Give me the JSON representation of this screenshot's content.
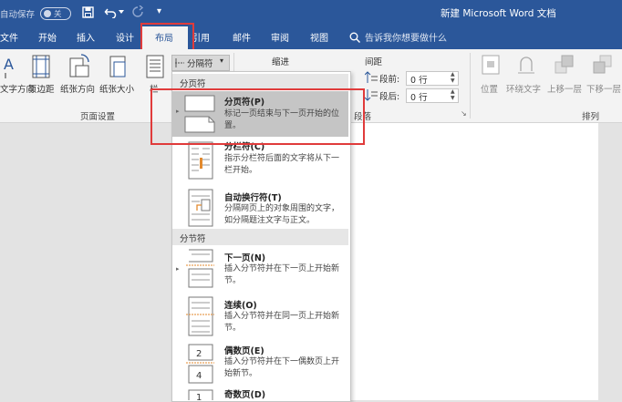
{
  "titlebar": {
    "autosave_label": "自动保存",
    "autosave_state": "关",
    "title": "新建 Microsoft Word 文档"
  },
  "tabs": [
    {
      "label": "文件"
    },
    {
      "label": "开始"
    },
    {
      "label": "插入"
    },
    {
      "label": "设计"
    },
    {
      "label": "布局"
    },
    {
      "label": "引用"
    },
    {
      "label": "邮件"
    },
    {
      "label": "审阅"
    },
    {
      "label": "视图"
    }
  ],
  "tellme": {
    "placeholder": "告诉我你想要做什么"
  },
  "ribbon": {
    "page_setup": {
      "buttons": [
        {
          "label": "文字方向"
        },
        {
          "label": "页边距"
        },
        {
          "label": "纸张方向"
        },
        {
          "label": "纸张大小"
        },
        {
          "label": "栏"
        }
      ],
      "group_label": "页面设置"
    },
    "breaks_label": "分隔符",
    "indent_label": "缩进",
    "spacing": {
      "label": "间距",
      "before_label": "段前:",
      "before_value": "0 行",
      "after_label": "段后:",
      "after_value": "0 行"
    },
    "paragraph_group_label": "段落",
    "arrange": {
      "buttons": [
        {
          "label": "位置"
        },
        {
          "label": "环绕文字"
        },
        {
          "label": "上移一层"
        },
        {
          "label": "下移一层"
        }
      ],
      "group_label": "排列"
    }
  },
  "breaks_menu": {
    "page_breaks_header": "分页符",
    "page_break_items": [
      {
        "title": "分页符(P)",
        "desc": "标记一页结束与下一页开始的位置。"
      },
      {
        "title": "分栏符(C)",
        "desc": "指示分栏符后面的文字将从下一栏开始。"
      },
      {
        "title": "自动换行符(T)",
        "desc": "分隔网页上的对象周围的文字，如分隔题注文字与正文。"
      }
    ],
    "section_breaks_header": "分节符",
    "section_break_items": [
      {
        "title": "下一页(N)",
        "desc": "插入分节符并在下一页上开始新节。"
      },
      {
        "title": "连续(O)",
        "desc": "插入分节符并在同一页上开始新节。"
      },
      {
        "title": "偶数页(E)",
        "desc": "插入分节符并在下一偶数页上开始新节。"
      },
      {
        "title": "奇数页(D)",
        "desc": ""
      }
    ]
  },
  "colors": {
    "brand": "#2b579a",
    "highlight": "#e03b3b"
  }
}
